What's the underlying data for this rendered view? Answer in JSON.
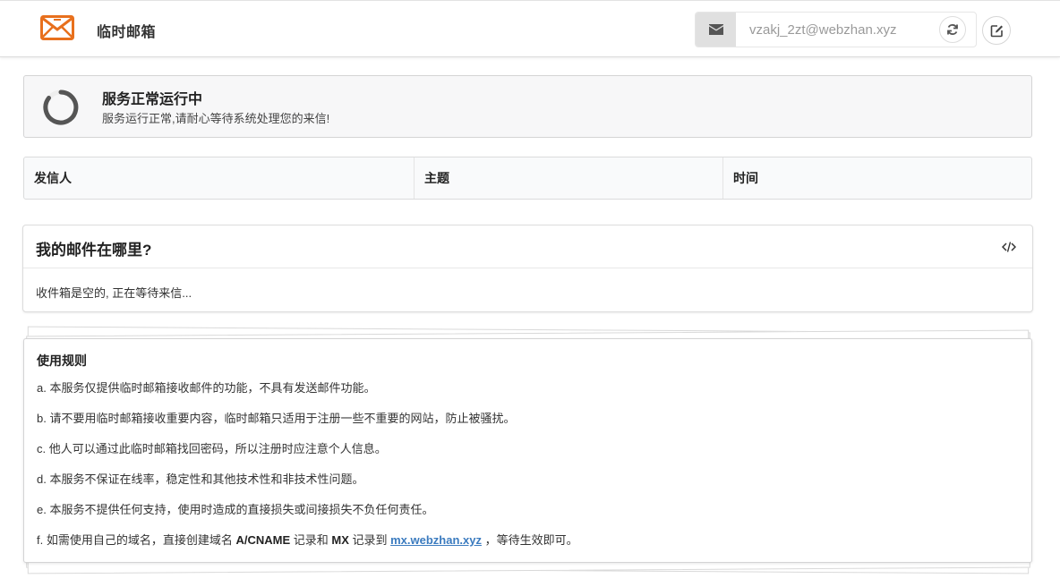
{
  "header": {
    "brand": "临时邮箱",
    "email_address": "vzakj_2zt@webzhan.xyz",
    "colors": {
      "logo": "#e8701d",
      "addon_bg": "#e0e0e0"
    },
    "icons": {
      "logo": "envelope-logo-icon",
      "addon": "envelope-icon",
      "refresh": "refresh-icon",
      "edit": "edit-icon"
    }
  },
  "status": {
    "title": "服务正常运行中",
    "description": "服务运行正常,请耐心等待系统处理您的来信!",
    "icon": "spinner-icon"
  },
  "mail_table": {
    "columns": [
      "发信人",
      "主题",
      "时间"
    ]
  },
  "where_card": {
    "title": "我的邮件在哪里?",
    "body": "收件箱是空的, 正在等待来信...",
    "icon": "code-icon"
  },
  "rules": {
    "title": "使用规则",
    "items": [
      "a. 本服务仅提供临时邮箱接收邮件的功能，不具有发送邮件功能。",
      "b. 请不要用临时邮箱接收重要内容，临时邮箱只适用于注册一些不重要的网站，防止被骚扰。",
      "c. 他人可以通过此临时邮箱找回密码，所以注册时应注意个人信息。",
      "d. 本服务不保证在线率，稳定性和其他技术性和非技术性问题。",
      "e. 本服务不提供任何支持，使用时造成的直接损失或间接损失不负任何责任。"
    ],
    "last": {
      "part1": "f. 如需使用自己的域名，直接创建域名 ",
      "record1": "A/CNAME",
      "part2": " 记录和 ",
      "record2": "MX",
      "part3": " 记录到 ",
      "link": "mx.webzhan.xyz",
      "part4": " ，等待生效即可。"
    },
    "link_color": "#3b7bbf"
  }
}
